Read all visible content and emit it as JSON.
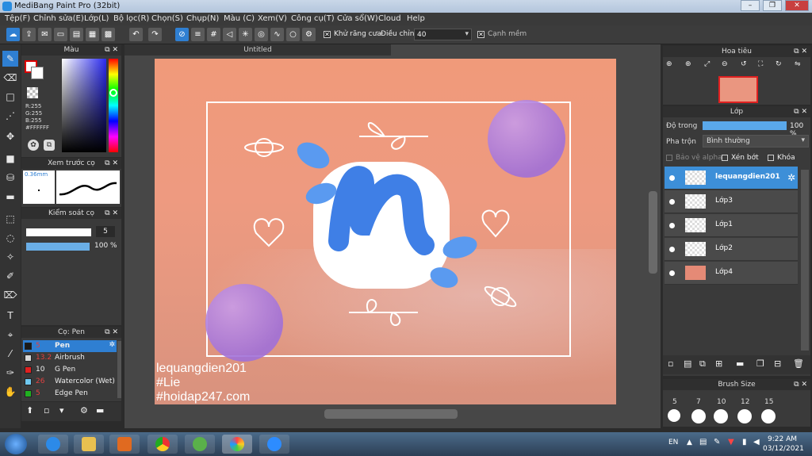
{
  "window": {
    "title": "MediBang Paint Pro (32bit)"
  },
  "menu": [
    "Tệp(F)",
    "Chỉnh sửa(E)",
    "Lớp(L)",
    "Bộ lọc(R)",
    "Chọn(S)",
    "Chụp(N)",
    "Màu (C)",
    "Xem(V)",
    "Công cụ(T)",
    "Cửa sổ(W)",
    "Cloud",
    "Help"
  ],
  "toolbar": {
    "antialias_label": "Khử răng cưa",
    "adjust_label": "Điều chỉnh",
    "adjust_value": "40",
    "edge_label": "Cạnh mềm"
  },
  "color_panel": {
    "title": "Màu",
    "r": "R:255",
    "g": "G:255",
    "b": "B:255",
    "hex": "#FFFFFF"
  },
  "brush_preview": {
    "title": "Xem trước cọ",
    "size": "0.36mm"
  },
  "brush_control": {
    "title": "Kiểm soát cọ",
    "size_value": "5",
    "opacity_value": "100 %"
  },
  "brush_list": {
    "title": "Cọ: Pen",
    "items": [
      {
        "size": "5",
        "name": "Pen",
        "color": "#1a1a1a"
      },
      {
        "size": "13.2",
        "name": "Airbrush",
        "color": "#d8d8d8"
      },
      {
        "size": "10",
        "name": "G Pen",
        "color": "#e02020"
      },
      {
        "size": "26",
        "name": "Watercolor (Wet)",
        "color": "#6fc8f0"
      },
      {
        "size": "5",
        "name": "Edge Pen",
        "color": "#20b020"
      }
    ]
  },
  "document": {
    "tab": "Untitled"
  },
  "artwork_text": {
    "line1": "lequangdien201",
    "line2": "#Lie",
    "line3": "#hoidap247.com"
  },
  "navigator": {
    "title": "Hoa tiêu"
  },
  "layers": {
    "title": "Lớp",
    "opacity_label": "Độ trong",
    "opacity_value": "100 %",
    "blend_label": "Pha trộn",
    "blend_value": "Bình thường",
    "protect_alpha": "Bảo vệ alpha",
    "clipping": "Xén bớt",
    "lock": "Khóa",
    "items": [
      "lequangdien201",
      "Lớp3",
      "Lớp1",
      "Lớp2",
      "Lớp4"
    ]
  },
  "brush_size": {
    "title": "Brush Size",
    "sizes": [
      "5",
      "7",
      "10",
      "12",
      "15"
    ]
  },
  "taskbar": {
    "lang": "EN",
    "time": "9:22 AM",
    "date": "03/12/2021"
  }
}
